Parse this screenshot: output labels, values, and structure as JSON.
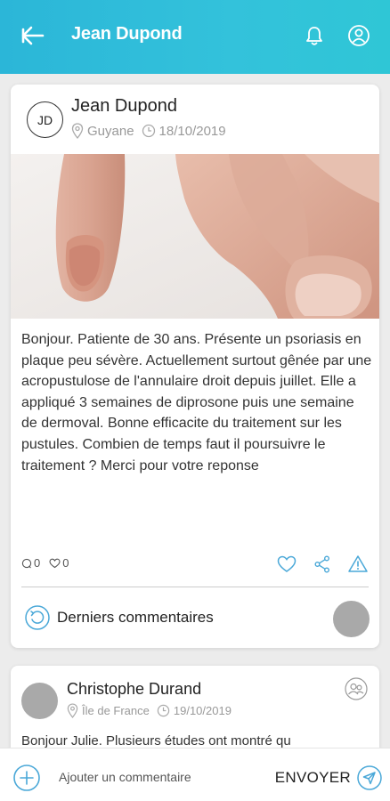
{
  "header": {
    "title": "Jean Dupond",
    "back_icon": "arrow-left-icon",
    "bell_icon": "bell-icon",
    "profile_icon": "user-circle-icon"
  },
  "post": {
    "author_initials": "JD",
    "author": "Jean Dupond",
    "location": "Guyane",
    "date": "18/10/2019",
    "image_alt": "Photo of a finger with damaged nail",
    "text": "Bonjour.  Patiente de 30 ans. Présente un psoriasis en plaque peu sévère. Actuellement surtout gênée par une acropustulose de l'annulaire droit depuis juillet.  Elle a appliqué 3 semaines de diprosone puis une semaine de dermoval. Bonne efficacite du traitement sur les pustules. Combien de temps faut il poursuivre le traitement ? Merci pour votre reponse",
    "comments_count": "0",
    "likes_count": "0",
    "comments_label": "Derniers commentaires"
  },
  "comment": {
    "author": "Christophe Durand",
    "location": "Île de France",
    "date": "19/10/2019",
    "text": "Bonjour Julie. Plusieurs études ont montré qu"
  },
  "bottom_bar": {
    "placeholder": "Ajouter un commentaire",
    "send_label": "ENVOYER"
  },
  "colors": {
    "accent": "#2bb6d8",
    "icon_blue": "#4aa8d8"
  }
}
